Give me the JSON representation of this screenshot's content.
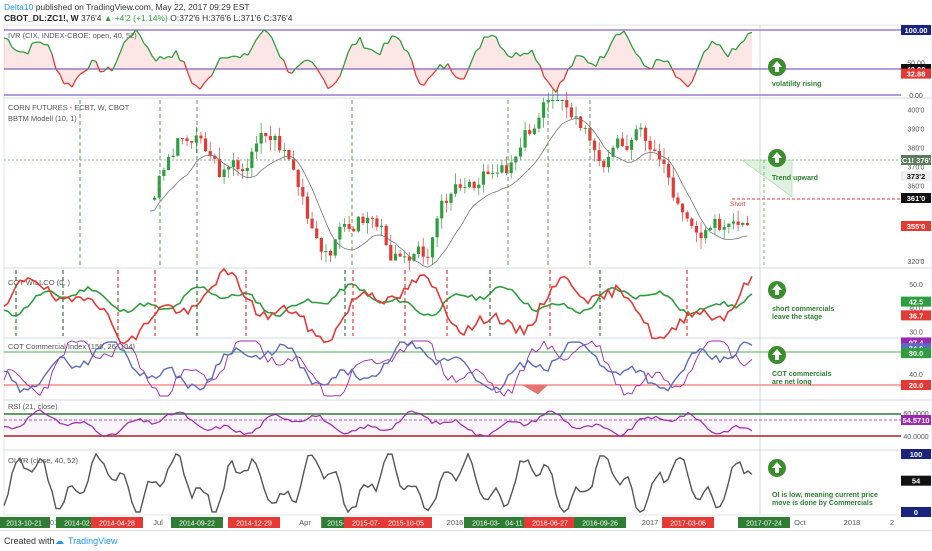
{
  "header": {
    "author": "Delta10",
    "published_text": "published on TradingView.com, May 22, 2017 09:29 EST",
    "symbol": "CBOT_DL:ZC1!, W",
    "last": "376'4",
    "change": "+4'2 (+1.14%)",
    "ohlc": "O:372'6 H:376'6 L:371'6 C:376'4"
  },
  "footer": {
    "created_with": "Created with",
    "brand": "TradingView"
  },
  "colors": {
    "green": "#2e9e3e",
    "red": "#e53935",
    "blue": "#5c6bc0",
    "purple": "#9c27b0",
    "navy": "#1a237e"
  },
  "panes": {
    "ivr": {
      "title": "IVR (CIX, INDEX-CBOE: open, 40, 52)",
      "ticks": [
        "100.00",
        "50.00",
        "40.00",
        "32.88",
        "0.00"
      ],
      "annotation": "volatility rising"
    },
    "price": {
      "title": "CORN FUTURES - ECBT, W, CBOT",
      "subtitle": "BBTM Modell (10, 1)",
      "ticks": [
        "400'0",
        "390'0",
        "380'0",
        "370'0",
        "360'0",
        "350'0",
        "340'0",
        "330'0",
        "320'0"
      ],
      "labels": [
        "ZC1!",
        "376'4",
        "373'2",
        "361'0",
        "355'0"
      ],
      "short_label": "Short",
      "annotation": "Trend upward"
    },
    "willco": {
      "title": "COT WILLCO (0, )",
      "ticks": [
        "50.0",
        "40.0",
        "30.0"
      ],
      "labels": [
        "42.5",
        "36.7"
      ],
      "annotation": "short commercials leave the stage"
    },
    "cotindex": {
      "title": "COT Commercial Index (156, 26, 104)",
      "ticks": [
        "40.0"
      ],
      "labels": [
        "97.4",
        "84.0",
        "80.0",
        "20.0"
      ],
      "annotation": "COT commercials are net long"
    },
    "rsi": {
      "title": "RSI (21, close)",
      "ticks": [
        "60.0000",
        "40.0000"
      ],
      "labels": [
        "54.5710"
      ]
    },
    "oivr": {
      "title": "OI VR (close, 40, 52)",
      "ticks": [
        "100",
        "54",
        "0"
      ],
      "annotation": "OI is low, meaning current price move is done by Commercials"
    }
  },
  "time_axis": [
    {
      "t": "2013-10-21",
      "c": "g"
    },
    {
      "t": "201",
      "c": "n"
    },
    {
      "t": "2014-02-17",
      "c": "g"
    },
    {
      "t": "2014-04-28",
      "c": "r"
    },
    {
      "t": "Jul",
      "c": "n"
    },
    {
      "t": "2014-09-22",
      "c": "g"
    },
    {
      "t": "2014-12-29",
      "c": "r"
    },
    {
      "t": "Apr",
      "c": "n"
    },
    {
      "t": "2015-0",
      "c": "g"
    },
    {
      "t": "2015-07-27",
      "c": "r"
    },
    {
      "t": "2015-10-05",
      "c": "r"
    },
    {
      "t": "2016",
      "c": "n"
    },
    {
      "t": "2016-03-07",
      "c": "g"
    },
    {
      "t": "04-11",
      "c": "g"
    },
    {
      "t": "2016-06-27",
      "c": "r"
    },
    {
      "t": "2016-09-26",
      "c": "g"
    },
    {
      "t": "2017",
      "c": "n"
    },
    {
      "t": "2017-03-06",
      "c": "r"
    },
    {
      "t": "2017-07-24",
      "c": "g"
    },
    {
      "t": "Oct",
      "c": "n"
    },
    {
      "t": "2018",
      "c": "n"
    },
    {
      "t": "2",
      "c": "n"
    }
  ],
  "chart_data": {
    "type": "line",
    "title": "CORN FUTURES - ECBT, W, CBOT",
    "x": [
      "2013-10-21",
      "2017-07-24"
    ],
    "series": [
      {
        "name": "IVR (CIX, INDEX-CBOE: open, 40, 52)",
        "last": 40.0,
        "ylim": [
          0,
          100
        ],
        "levels": [
          100.0,
          40.0,
          32.88,
          0.0
        ]
      },
      {
        "name": "CORN FUTURES - ECBT, W, CBOT",
        "last": 376.5,
        "ylim": [
          318,
          405
        ],
        "levels": [
          373.25,
          361.0,
          355.0
        ]
      },
      {
        "name": "COT WILLCO (0, )",
        "last": [
          42.5,
          36.7
        ],
        "ylim": [
          28,
          55
        ]
      },
      {
        "name": "COT Commercial Index (156, 26, 104)",
        "last": [
          97.4,
          84.0,
          80.0
        ],
        "levels": [
          80.0,
          20.0
        ]
      },
      {
        "name": "RSI (21, close)",
        "last": 54.571,
        "levels": [
          60.0,
          40.0
        ]
      },
      {
        "name": "OI VR (close, 40, 52)",
        "last": 54,
        "ylim": [
          0,
          100
        ]
      }
    ]
  }
}
